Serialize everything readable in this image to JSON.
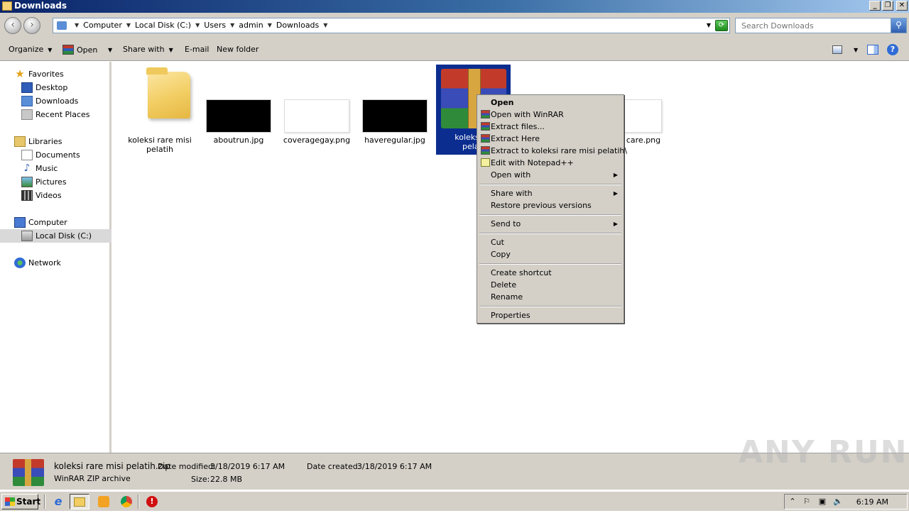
{
  "window": {
    "title": "Downloads"
  },
  "address": {
    "crumbs": [
      "Computer",
      "Local Disk (C:)",
      "Users",
      "admin",
      "Downloads"
    ]
  },
  "search": {
    "placeholder": "Search Downloads"
  },
  "toolbar": {
    "organize": "Organize",
    "open": "Open",
    "share_with": "Share with",
    "email": "E-mail",
    "new_folder": "New folder"
  },
  "nav": {
    "favorites": "Favorites",
    "desktop": "Desktop",
    "downloads": "Downloads",
    "recent_places": "Recent Places",
    "libraries": "Libraries",
    "documents": "Documents",
    "music": "Music",
    "pictures": "Pictures",
    "videos": "Videos",
    "computer": "Computer",
    "local_disk": "Local Disk (C:)",
    "network": "Network"
  },
  "files": {
    "folder_line1": "koleksi rare misi",
    "folder_line2": "pelatih",
    "aboutrun": "aboutrun.jpg",
    "coveragegay": "coveragegay.png",
    "haveregular": "haveregular.jpg",
    "selected_line1": "koleksi ra",
    "selected_line2": "pelati",
    "partial": "care.png"
  },
  "context_menu": {
    "open": "Open",
    "open_with_winrar": "Open with WinRAR",
    "extract_files": "Extract files...",
    "extract_here": "Extract Here",
    "extract_to": "Extract to koleksi rare misi pelatih\\",
    "edit_notepad": "Edit with Notepad++",
    "open_with": "Open with",
    "share_with": "Share with",
    "restore_previous": "Restore previous versions",
    "send_to": "Send to",
    "cut": "Cut",
    "copy": "Copy",
    "create_shortcut": "Create shortcut",
    "delete": "Delete",
    "rename": "Rename",
    "properties": "Properties"
  },
  "details": {
    "filename": "koleksi rare misi pelatih.zip",
    "type": "WinRAR ZIP archive",
    "date_modified_label": "Date modified:",
    "date_modified": "3/18/2019 6:17 AM",
    "date_created_label": "Date created:",
    "date_created": "3/18/2019 6:17 AM",
    "size_label": "Size:",
    "size": "22.8 MB"
  },
  "watermark": "ANY RUN",
  "taskbar": {
    "start": "Start",
    "clock": "6:19 AM"
  }
}
